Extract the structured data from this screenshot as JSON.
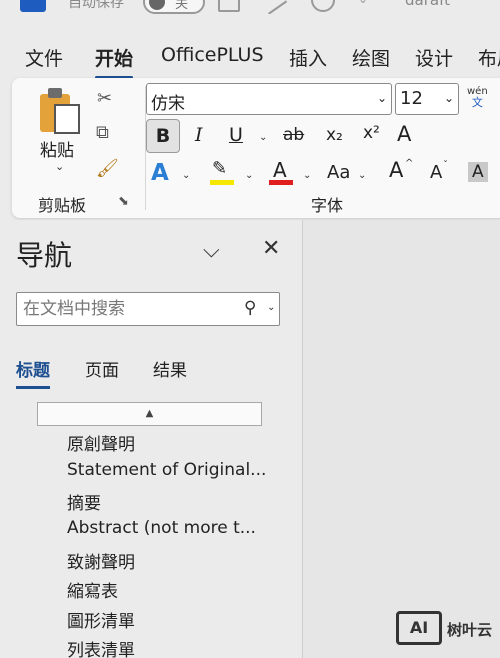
{
  "titlebar": {
    "autosave_label": "自动保存",
    "toggle_state": "关",
    "doc_name": "daraft"
  },
  "menu": {
    "tabs": [
      "文件",
      "开始",
      "OfficePLUS",
      "插入",
      "绘图",
      "设计",
      "布局"
    ],
    "active": "开始"
  },
  "ribbon": {
    "clipboard": {
      "paste_label": "粘贴",
      "group_label": "剪贴板"
    },
    "font": {
      "font_name": "仿宋",
      "font_size": "12",
      "wen_pinyin": "wén",
      "wen_char": "文",
      "bold": "B",
      "italic": "I",
      "underline": "U",
      "strike": "ab",
      "subscript": "x₂",
      "superscript": "x²",
      "clear": "A",
      "text_effect": "A",
      "font_color": "A",
      "change_case": "Aa",
      "grow": "A",
      "shrink": "A",
      "shading": "A",
      "group_label": "字体",
      "highlight_color": "#f5e800",
      "font_color_value": "#e01e1e",
      "accent_color": "#1d4f91"
    }
  },
  "nav": {
    "title": "导航",
    "search_placeholder": "在文档中搜索",
    "tabs": [
      "标题",
      "页面",
      "结果"
    ],
    "active_tab": "标题",
    "headings": [
      "原創聲明",
      "Statement of Original...",
      "摘要",
      "Abstract (not more t...",
      "致謝聲明",
      "縮寫表",
      "圖形清單",
      "列表清單"
    ]
  },
  "watermark": {
    "badge": "AI",
    "text": "树叶云"
  }
}
